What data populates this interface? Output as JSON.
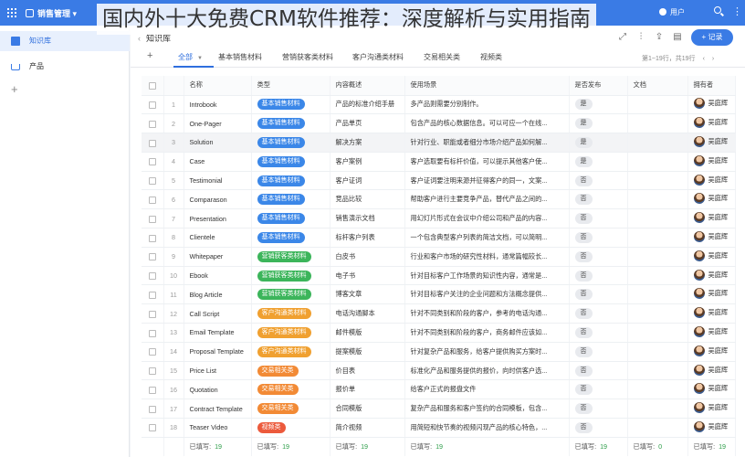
{
  "topbar": {
    "app_name": "销售管理",
    "user_label": "用户"
  },
  "sidebar": {
    "items": [
      {
        "label": "知识库",
        "icon": "book-icon",
        "active": true
      },
      {
        "label": "产品",
        "icon": "cart-icon",
        "active": false
      }
    ]
  },
  "header": {
    "title": "知识库",
    "record_button": "+ 记录"
  },
  "tabs": [
    {
      "label": "全部",
      "active": true
    },
    {
      "label": "基本销售材料"
    },
    {
      "label": "营销获客类材料"
    },
    {
      "label": "客户沟通类材料"
    },
    {
      "label": "交易相关类"
    },
    {
      "label": "视频类"
    }
  ],
  "pager": "第1~19行，共19行",
  "table": {
    "columns": [
      "名称",
      "类型",
      "内容概述",
      "使用场景",
      "是否发布",
      "文档",
      "拥有者"
    ],
    "rows": [
      {
        "idx": "1",
        "name": "Introbook",
        "type": "基本销售材料",
        "type_color": "#3b87e8",
        "summary": "产品的标准介绍手册",
        "usage": "多产品则需要分别制作。",
        "published": "是",
        "owner": "吴庭辉"
      },
      {
        "idx": "2",
        "name": "One-Pager",
        "type": "基本销售材料",
        "type_color": "#3b87e8",
        "summary": "产品单页",
        "usage": "包含产品的核心数据信息。可以可应一个在线...",
        "published": "是",
        "owner": "吴庭辉"
      },
      {
        "idx": "3",
        "name": "Solution",
        "type": "基本销售材料",
        "type_color": "#3b87e8",
        "summary": "解决方案",
        "usage": "针对行业、职能或者细分市场介绍产品如何解...",
        "published": "是",
        "owner": "吴庭辉"
      },
      {
        "idx": "4",
        "name": "Case",
        "type": "基本销售材料",
        "type_color": "#3b87e8",
        "summary": "客户案例",
        "usage": "客户选取要有标杆价值，可以提示其他客户使...",
        "published": "是",
        "owner": "吴庭辉"
      },
      {
        "idx": "5",
        "name": "Testimonial",
        "type": "基本销售材料",
        "type_color": "#3b87e8",
        "summary": "客户证词",
        "usage": "客户证词要注明来源并征得客户的同一，文案...",
        "published": "否",
        "owner": "吴庭辉"
      },
      {
        "idx": "6",
        "name": "Comparason",
        "type": "基本销售材料",
        "type_color": "#3b87e8",
        "summary": "竞品比较",
        "usage": "帮助客户进行主要竞争产品，替代产品之间的...",
        "published": "否",
        "owner": "吴庭辉"
      },
      {
        "idx": "7",
        "name": "Presentation",
        "type": "基本销售材料",
        "type_color": "#3b87e8",
        "summary": "销售演示文档",
        "usage": "用幻灯片形式在会议中介绍公司和产品的内容...",
        "published": "否",
        "owner": "吴庭辉"
      },
      {
        "idx": "8",
        "name": "Clientele",
        "type": "基本销售材料",
        "type_color": "#3b87e8",
        "summary": "标杆客户列表",
        "usage": "一个包含典型客户列表的简洁文档，可以简明...",
        "published": "否",
        "owner": "吴庭辉"
      },
      {
        "idx": "9",
        "name": "Whitepaper",
        "type": "营销获客类材料",
        "type_color": "#3cb55b",
        "summary": "白皮书",
        "usage": "行业和客户市场的研究性材料，通常篇幅较长...",
        "published": "否",
        "owner": "吴庭辉"
      },
      {
        "idx": "10",
        "name": "Ebook",
        "type": "营销获客类材料",
        "type_color": "#3cb55b",
        "summary": "电子书",
        "usage": "针对目标客户工作场景的知识性内容，通常是...",
        "published": "否",
        "owner": "吴庭辉"
      },
      {
        "idx": "11",
        "name": "Blog Article",
        "type": "营销获客类材料",
        "type_color": "#3cb55b",
        "summary": "博客文章",
        "usage": "针对目标客户关注的企业问题和方法概念提供...",
        "published": "否",
        "owner": "吴庭辉"
      },
      {
        "idx": "12",
        "name": "Call Script",
        "type": "客户沟通类材料",
        "type_color": "#f0a030",
        "summary": "电话沟通脚本",
        "usage": "针对不同类别和阶段的客户，参考的电话沟通...",
        "published": "否",
        "owner": "吴庭辉"
      },
      {
        "idx": "13",
        "name": "Email Template",
        "type": "客户沟通类材料",
        "type_color": "#f0a030",
        "summary": "邮件模版",
        "usage": "针对不同类别和阶段的客户，商务邮件应该如...",
        "published": "否",
        "owner": "吴庭辉"
      },
      {
        "idx": "14",
        "name": "Proposal Template",
        "type": "客户沟通类材料",
        "type_color": "#f0a030",
        "summary": "提案模版",
        "usage": "针对复杂产品和服务，给客户提供购买方案时...",
        "published": "否",
        "owner": "吴庭辉"
      },
      {
        "idx": "15",
        "name": "Price List",
        "type": "交易相关类",
        "type_color": "#f28a35",
        "summary": "价目表",
        "usage": "标准化产品和服务提供的报价，向时供客户选...",
        "published": "否",
        "owner": "吴庭辉"
      },
      {
        "idx": "16",
        "name": "Quotation",
        "type": "交易相关类",
        "type_color": "#f28a35",
        "summary": "报价单",
        "usage": "给客户正式的报盘文件",
        "published": "否",
        "owner": "吴庭辉"
      },
      {
        "idx": "17",
        "name": "Contract Template",
        "type": "交易相关类",
        "type_color": "#f28a35",
        "summary": "合同模版",
        "usage": "复杂产品和服务和客户签约的合同模板，包含...",
        "published": "否",
        "owner": "吴庭辉"
      },
      {
        "idx": "18",
        "name": "Teaser Video",
        "type": "视频类",
        "type_color": "#ec5a3c",
        "summary": "简介视频",
        "usage": "用简短和快节奏的视频闪现产品的核心特色，...",
        "published": "否",
        "owner": "吴庭辉"
      }
    ],
    "footer": {
      "label": "已填写:",
      "name": "19",
      "type": "19",
      "summary": "19",
      "usage": "19",
      "published": "19",
      "doc": "0",
      "owner": "19"
    }
  },
  "headline": "国内外十大免费CRM软件推荐：深度解析与实用指南"
}
